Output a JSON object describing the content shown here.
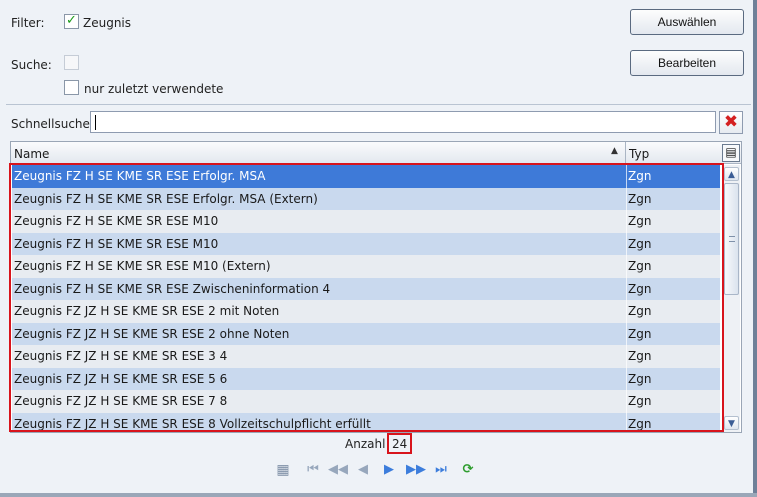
{
  "filter": {
    "label": "Filter:",
    "checkbox_label": "Zeugnis",
    "checked": true
  },
  "suche": {
    "label": "Suche:",
    "recent_label": "nur zuletzt verwendete"
  },
  "buttons": {
    "select": "Auswählen",
    "edit": "Bearbeiten"
  },
  "quicksearch": {
    "label": "Schnellsuche",
    "value": "",
    "clear_icon": "x-icon"
  },
  "grid": {
    "columns": {
      "name": "Name",
      "type": "Typ"
    },
    "rows": [
      {
        "name": "Zeugnis FZ H SE KME SR ESE Erfolgr. MSA",
        "type": "Zgn"
      },
      {
        "name": "Zeugnis FZ H SE KME SR ESE Erfolgr. MSA (Extern)",
        "type": "Zgn"
      },
      {
        "name": "Zeugnis FZ H SE KME SR ESE M10",
        "type": "Zgn"
      },
      {
        "name": "Zeugnis FZ H SE KME SR ESE M10",
        "type": "Zgn"
      },
      {
        "name": "Zeugnis FZ H SE KME SR ESE M10 (Extern)",
        "type": "Zgn"
      },
      {
        "name": "Zeugnis FZ H SE KME SR ESE Zwischeninformation 4",
        "type": "Zgn"
      },
      {
        "name": "Zeugnis FZ JZ H SE KME SR ESE 2 mit Noten",
        "type": "Zgn"
      },
      {
        "name": "Zeugnis FZ JZ H SE KME SR ESE 2 ohne Noten",
        "type": "Zgn"
      },
      {
        "name": "Zeugnis FZ JZ H SE KME SR ESE 3 4",
        "type": "Zgn"
      },
      {
        "name": "Zeugnis FZ JZ H SE KME SR ESE 5 6",
        "type": "Zgn"
      },
      {
        "name": "Zeugnis FZ JZ H SE KME SR ESE 7 8",
        "type": "Zgn"
      },
      {
        "name": "Zeugnis FZ JZ H SE KME SR ESE 8 Vollzeitschulpflicht erfüllt",
        "type": "Zgn"
      }
    ]
  },
  "footer": {
    "count_label": "Anzahl",
    "count_value": "24"
  },
  "colors": {
    "selection": "#3e7ad8",
    "highlight_frame": "#d8141c",
    "row_alt": "#c9d9ee"
  }
}
